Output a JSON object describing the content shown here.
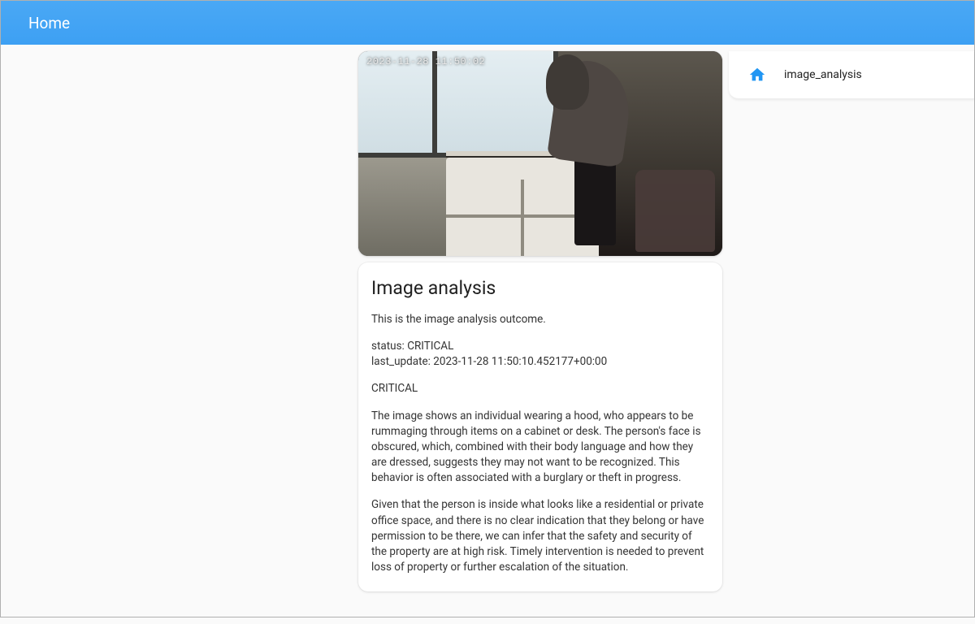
{
  "header": {
    "title": "Home"
  },
  "colors": {
    "accent": "#42a5f5",
    "icon": "#2196f3"
  },
  "camera": {
    "timestamp_overlay": "2023-11-28  11:50:02"
  },
  "side": {
    "label": "image_analysis"
  },
  "analysis": {
    "heading": "Image analysis",
    "intro": "This is the image analysis outcome.",
    "status_label": "status:",
    "status_value": "CRITICAL",
    "last_update_label": "last_update:",
    "last_update_value": "2023-11-28 11:50:10.452177+00:00",
    "severity": "CRITICAL",
    "paragraph1": "The image shows an individual wearing a hood, who appears to be rummaging through items on a cabinet or desk. The person's face is obscured, which, combined with their body language and how they are dressed, suggests they may not want to be recognized. This behavior is often associated with a burglary or theft in progress.",
    "paragraph2": "Given that the person is inside what looks like a residential or private office space, and there is no clear indication that they belong or have permission to be there, we can infer that the safety and security of the property are at high risk. Timely intervention is needed to prevent loss of property or further escalation of the situation."
  }
}
